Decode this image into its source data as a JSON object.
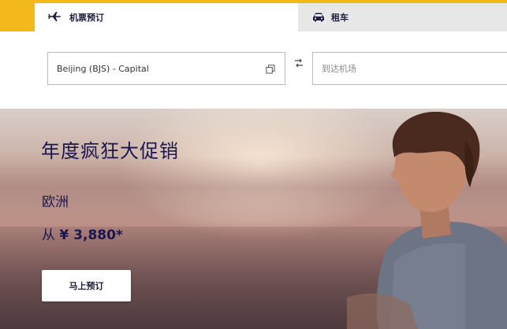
{
  "tabs": {
    "flight": {
      "label": "机票预订",
      "icon": "airplane-icon"
    },
    "car": {
      "label": "租车",
      "icon": "car-icon"
    }
  },
  "search": {
    "from_value": "Beijing (BJS) - Capital",
    "to_placeholder": "到达机场"
  },
  "hero": {
    "title": "年度疯狂大促销",
    "region": "欧洲",
    "price_prefix": "从",
    "price_value": "¥ 3,880*",
    "cta_label": "马上预订"
  },
  "colors": {
    "accent": "#f2b81c",
    "text_primary": "#1a1650"
  }
}
